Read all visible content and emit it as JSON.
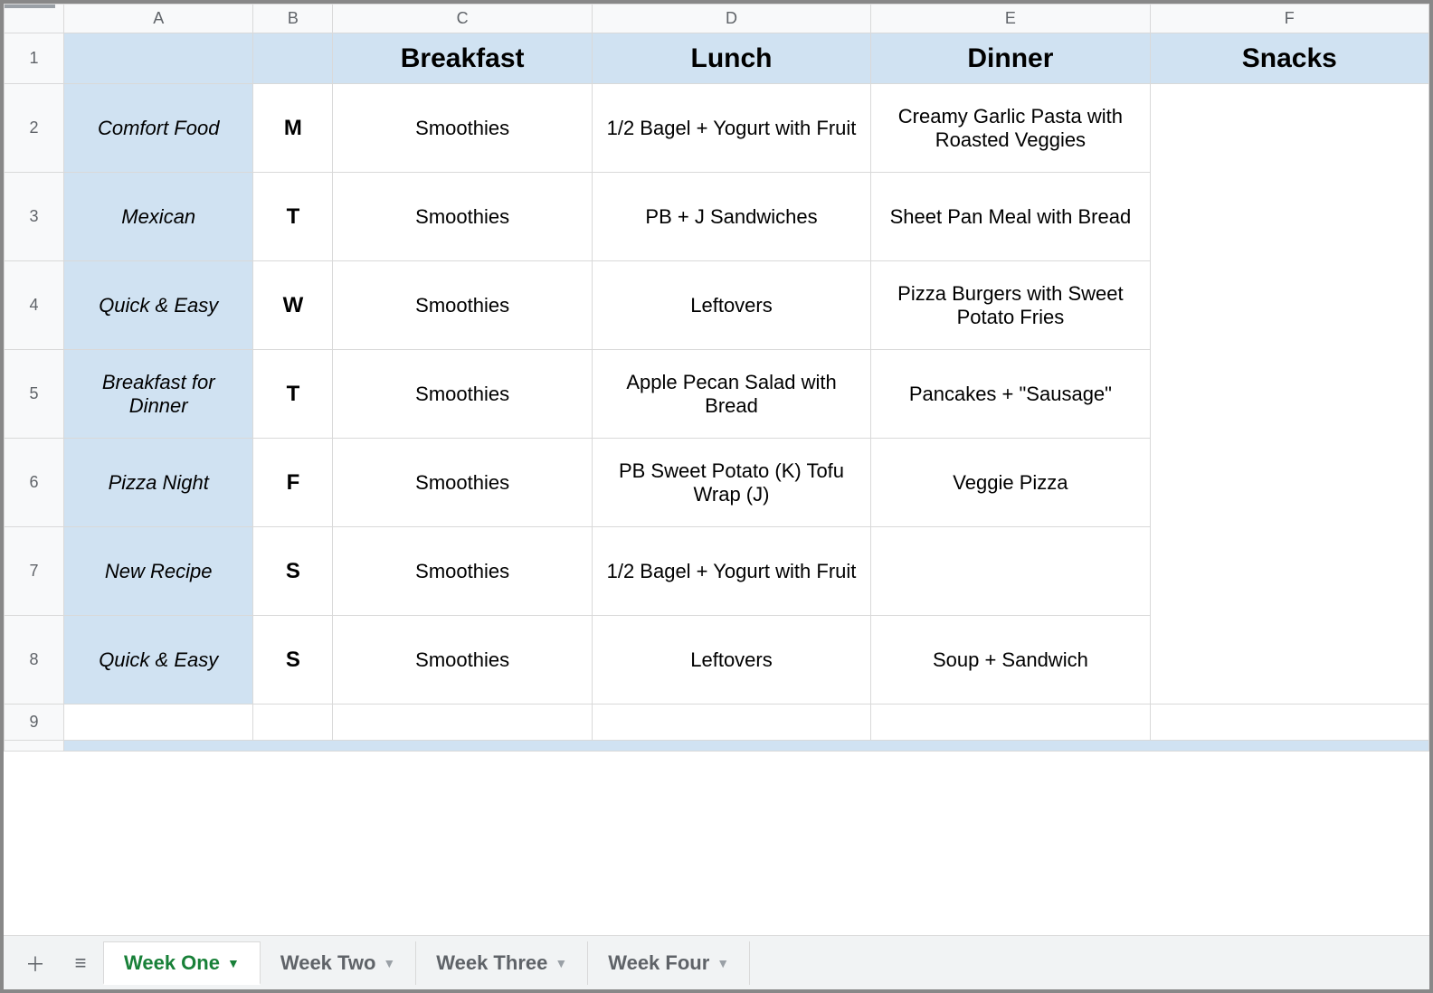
{
  "columns": [
    "A",
    "B",
    "C",
    "D",
    "E",
    "F"
  ],
  "header_row": {
    "A": "",
    "B": "",
    "C": "Breakfast",
    "D": "Lunch",
    "E": "Dinner",
    "F": "Snacks"
  },
  "rows": [
    {
      "num": "2",
      "theme": "Comfort Food",
      "day": "M",
      "breakfast": "Smoothies",
      "lunch": "1/2 Bagel + Yogurt with Fruit",
      "dinner": "Creamy Garlic Pasta with Roasted Veggies",
      "snacks": ""
    },
    {
      "num": "3",
      "theme": "Mexican",
      "day": "T",
      "breakfast": "Smoothies",
      "lunch": "PB + J Sandwiches",
      "dinner": "Sheet Pan Meal with Bread",
      "snacks": ""
    },
    {
      "num": "4",
      "theme": "Quick & Easy",
      "day": "W",
      "breakfast": "Smoothies",
      "lunch": "Leftovers",
      "dinner": "Pizza Burgers with Sweet Potato Fries",
      "snacks": ""
    },
    {
      "num": "5",
      "theme": "Breakfast for Dinner",
      "day": "T",
      "breakfast": "Smoothies",
      "lunch": "Apple Pecan Salad with Bread",
      "dinner": "Pancakes + \"Sausage\"",
      "snacks": ""
    },
    {
      "num": "6",
      "theme": "Pizza Night",
      "day": "F",
      "breakfast": "Smoothies",
      "lunch": "PB Sweet Potato (K) Tofu Wrap (J)",
      "dinner": "Veggie Pizza",
      "snacks": ""
    },
    {
      "num": "7",
      "theme": "New Recipe",
      "day": "S",
      "breakfast": "Smoothies",
      "lunch": "1/2 Bagel + Yogurt with Fruit",
      "dinner": "",
      "snacks": ""
    },
    {
      "num": "8",
      "theme": "Quick & Easy",
      "day": "S",
      "breakfast": "Smoothies",
      "lunch": "Leftovers",
      "dinner": "Soup + Sandwich",
      "snacks": ""
    }
  ],
  "empty_row_num": "9",
  "tabs": {
    "active": "Week One",
    "others": [
      "Week Two",
      "Week Three",
      "Week Four"
    ]
  }
}
